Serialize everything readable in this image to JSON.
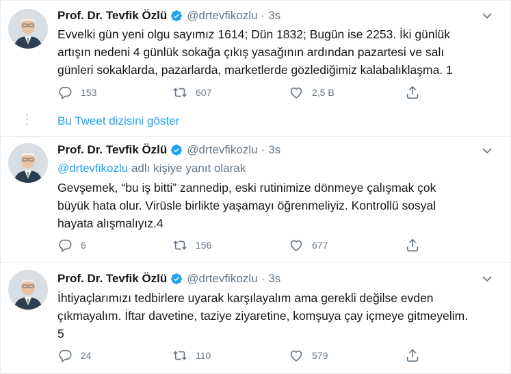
{
  "author": {
    "name": "Prof. Dr. Tevfik Özlü",
    "handle": "@drtevfikozlu",
    "separator": "·",
    "verified": true
  },
  "colors": {
    "accent": "#1da1f2",
    "secondary_text": "#657786",
    "primary_text": "#14171a",
    "border": "#e6ecf0"
  },
  "icons": {
    "reply": "speech-bubble-icon",
    "retweet": "retweet-icon",
    "like": "heart-icon",
    "share": "share-icon",
    "verified": "verified-badge-icon",
    "more": "chevron-down-icon"
  },
  "show_thread_label": "Bu Tweet dizisini göster",
  "tweets": [
    {
      "time": "3s",
      "lines": [
        "Evvelki gün yeni olgu sayımız 1614; Dün 1832; Bugün ise 2253. İki günlük",
        "artışın nedeni 4 günlük sokağa çıkış yasağının ardından pazartesi ve salı",
        "günleri sokaklarda, pazarlarda, marketlerde gözlediğimiz kalabalıklaşma. 1"
      ],
      "replies": "153",
      "retweets": "607",
      "likes": "2,5 B"
    },
    {
      "time": "3s",
      "reply_to": {
        "mention": "@drtevfikozlu",
        "suffix": " adlı kişiye yanıt olarak"
      },
      "lines": [
        "Gevşemek, “bu iş bitti” zannedip, eski rutinimize dönmeye çalışmak çok",
        "büyük hata olur. Virüsle birlikte yaşamayı öğrenmeliyiz. Kontrollü sosyal",
        "hayata alışmalıyız.4"
      ],
      "replies": "6",
      "retweets": "156",
      "likes": "677"
    },
    {
      "time": "3s",
      "lines": [
        "İhtiyaçlarımızı tedbirlere uyarak karşılayalım ama gerekli değilse evden",
        "çıkmayalım. İftar davetine, taziye ziyaretine, komşuya çay içmeye gitmeyelim.",
        "5"
      ],
      "replies": "24",
      "retweets": "110",
      "likes": "579"
    }
  ]
}
